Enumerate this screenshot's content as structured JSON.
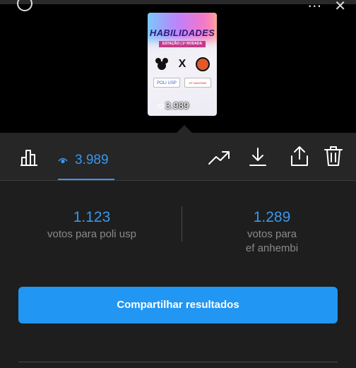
{
  "story_preview": {
    "title": "HABILIDADES",
    "subtitle": "ESTAÇÃO | 2ª RODADA",
    "team_a_box": "POLI USP",
    "team_b_box": "EF ANHEMBI",
    "view_count": "3.989"
  },
  "toolbar": {
    "view_count": "3.989",
    "icons": [
      "bar-chart-icon",
      "eye-icon",
      "trending-icon",
      "download-icon",
      "share-icon",
      "trash-icon"
    ]
  },
  "poll": {
    "option_a": {
      "count": "1.123",
      "label": "votos para poli usp"
    },
    "option_b": {
      "count": "1.289",
      "label_line1": "votos para",
      "label_line2": "ef anhembi"
    }
  },
  "share_button_label": "Compartilhar resultados",
  "colors": {
    "accent": "#3897f0",
    "button": "#2196f3",
    "panel": "#262626",
    "results_bg": "#1e1e1e"
  }
}
